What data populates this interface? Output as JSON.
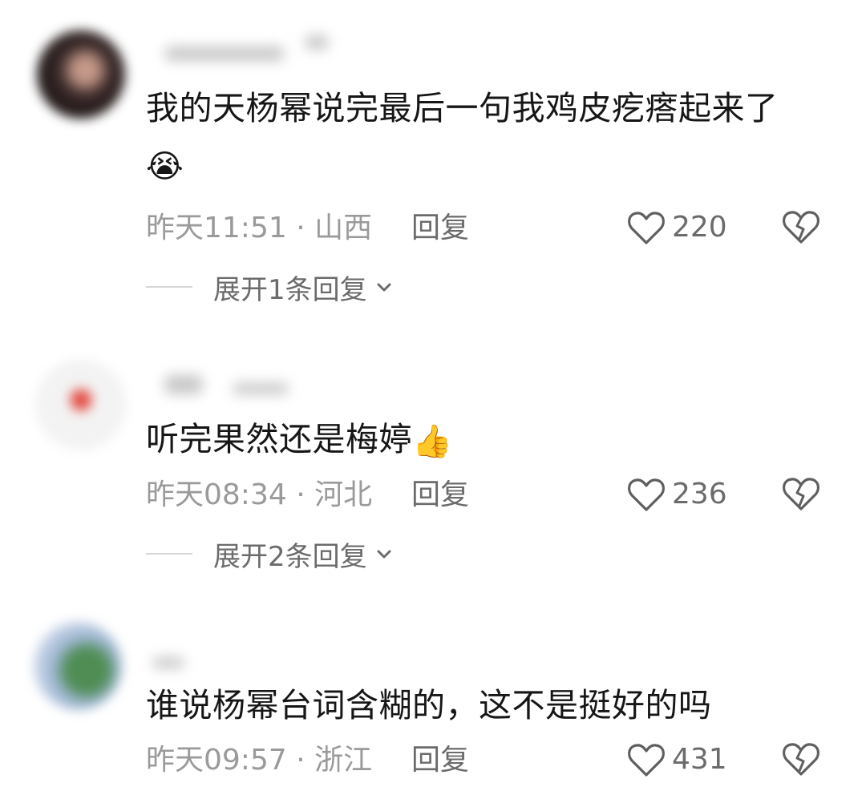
{
  "comments": [
    {
      "text": "我的天杨幂说完最后一句我鸡皮疙瘩起来了",
      "emoji": "😭",
      "time": "昨天11:51",
      "location": "山西",
      "reply_label": "回复",
      "likes": "220",
      "expand_label": "展开1条回复"
    },
    {
      "text": "听完果然还是梅婷",
      "emoji": "👍",
      "time": "昨天08:34",
      "location": "河北",
      "reply_label": "回复",
      "likes": "236",
      "expand_label": "展开2条回复"
    },
    {
      "text": "谁说杨幂台词含糊的，这不是挺好的吗",
      "emoji": "",
      "time": "昨天09:57",
      "location": "浙江",
      "reply_label": "回复",
      "likes": "431",
      "expand_label": ""
    }
  ],
  "meta_separator": "·",
  "icons": {
    "like": "heart-outline-icon",
    "dislike": "broken-heart-icon",
    "expand": "chevron-down-icon"
  },
  "colors": {
    "text": "#161616",
    "meta": "#9a9a9a",
    "secondary": "#6b6b6b"
  }
}
